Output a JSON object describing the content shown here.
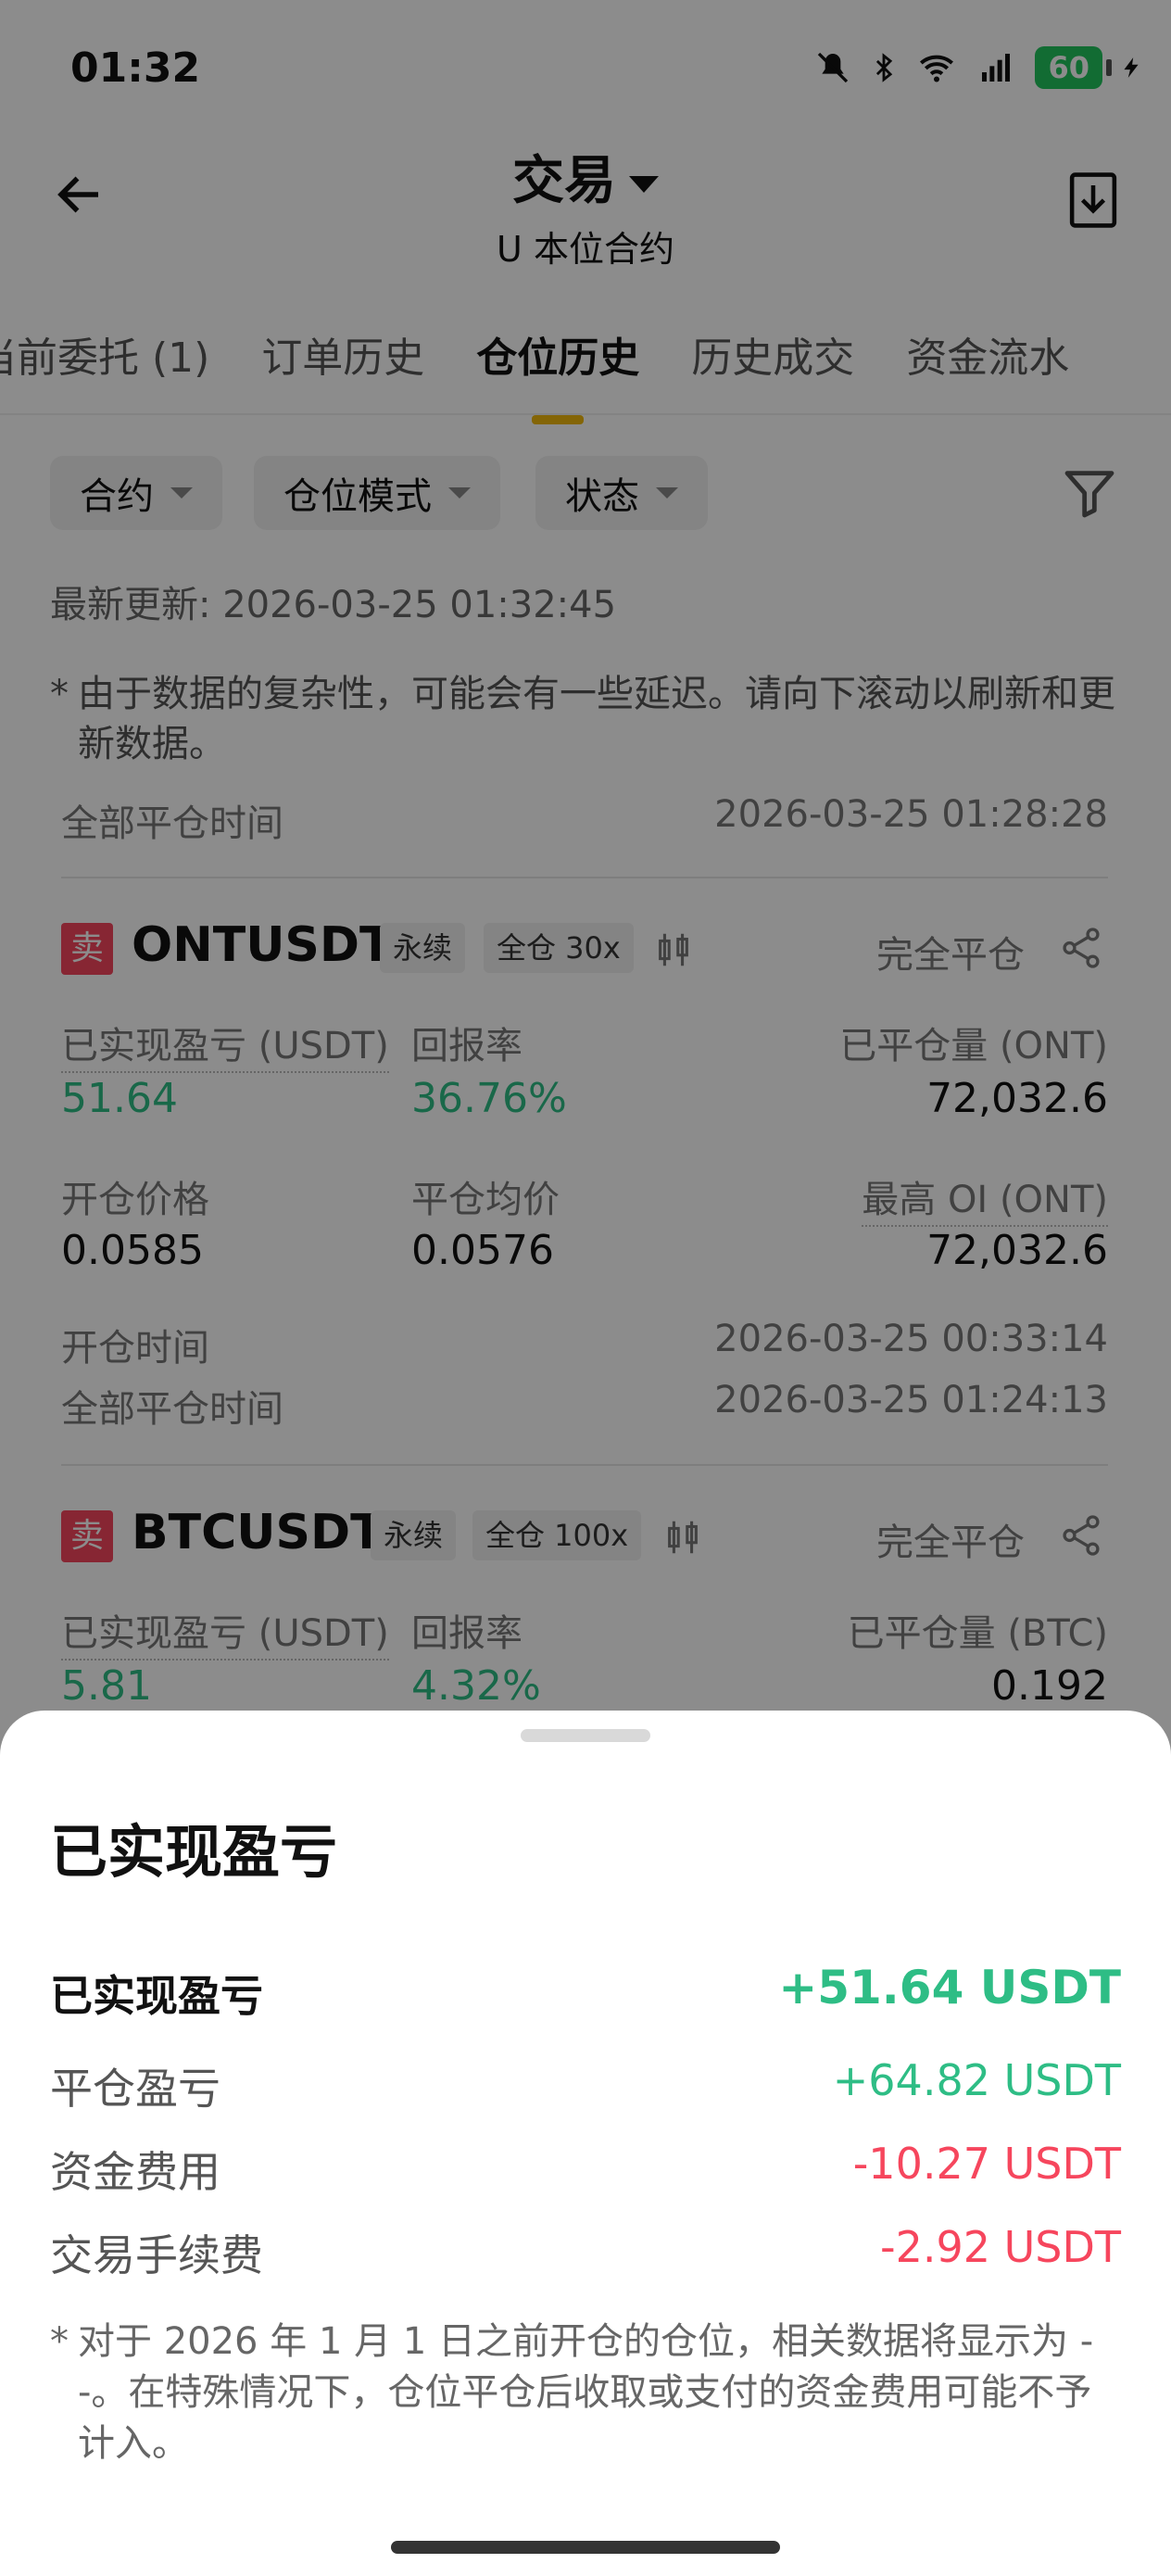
{
  "status_bar": {
    "time": "01:32",
    "battery": "60"
  },
  "header": {
    "title": "交易",
    "subtitle": "U 本位合约"
  },
  "tabs": [
    {
      "label": "当前委托 (1)"
    },
    {
      "label": "订单历史"
    },
    {
      "label": "仓位历史",
      "active": true
    },
    {
      "label": "历史成交"
    },
    {
      "label": "资金流水"
    }
  ],
  "filters": [
    {
      "label": "合约"
    },
    {
      "label": "仓位模式"
    },
    {
      "label": "状态"
    }
  ],
  "last_updated": "最新更新: 2026-03-25 01:32:45",
  "notice": {
    "star": "*",
    "text": "由于数据的复杂性，可能会有一些延迟。请向下滚动以刷新和更新数据。"
  },
  "partial_row": {
    "label": "全部平仓时间",
    "value": "2026-03-25 01:28:28"
  },
  "positions": [
    {
      "side": "卖",
      "symbol": "ONTUSDT",
      "type": "永续",
      "margin": "全仓 30x",
      "status": "完全平仓",
      "pnl_label": "已实现盈亏 (USDT)",
      "pnl": "51.64",
      "roi_label": "回报率",
      "roi": "36.76%",
      "closed_label": "已平仓量 (ONT)",
      "closed": "72,032.6",
      "entry_label": "开仓价格",
      "entry": "0.0585",
      "exit_label": "平仓均价",
      "exit": "0.0576",
      "maxoi_label": "最高 OI (ONT)",
      "maxoi": "72,032.6",
      "open_time_label": "开仓时间",
      "open_time": "2026-03-25 00:33:14",
      "close_time_label": "全部平仓时间",
      "close_time": "2026-03-25 01:24:13"
    },
    {
      "side": "卖",
      "symbol": "BTCUSDT",
      "type": "永续",
      "margin": "全仓 100x",
      "status": "完全平仓",
      "pnl_label": "已实现盈亏 (USDT)",
      "pnl": "5.81",
      "roi_label": "回报率",
      "roi": "4.32%",
      "closed_label": "已平仓量 (BTC)",
      "closed": "0.192"
    }
  ],
  "sheet": {
    "title": "已实现盈亏",
    "rows": [
      {
        "label": "已实现盈亏",
        "value": "+51.64 USDT"
      },
      {
        "label": "平仓盈亏",
        "value": "+64.82 USDT"
      },
      {
        "label": "资金费用",
        "value": "-10.27 USDT"
      },
      {
        "label": "交易手续费",
        "value": "-2.92 USDT"
      }
    ],
    "note_star": "*",
    "note": "对于 2026 年 1 月 1 日之前开仓的仓位，相关数据将显示为 --。在特殊情况下，仓位平仓后收取或支付的资金费用可能不予计入。"
  },
  "colors": {
    "up": "#2ebd85",
    "down": "#f6465d",
    "accent": "#f0b90b"
  }
}
